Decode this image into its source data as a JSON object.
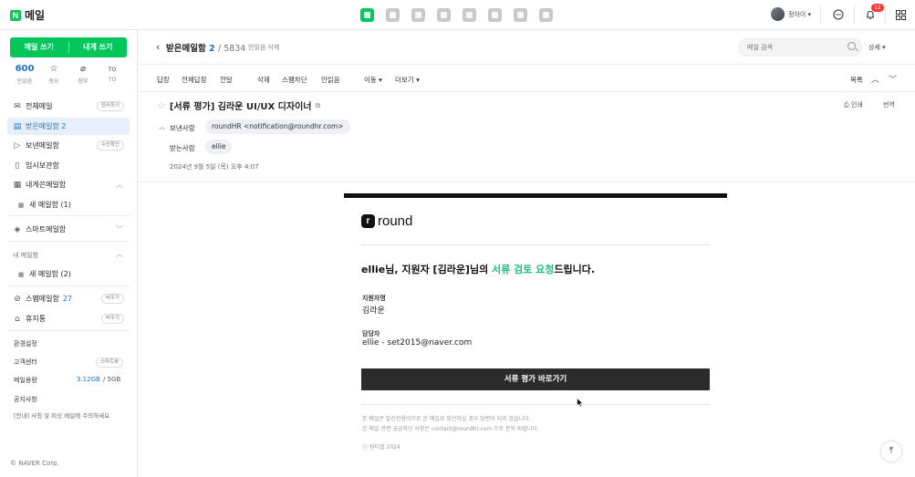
{
  "header": {
    "logo_letter": "N",
    "logo_text": "메일",
    "apps": [
      "mail-icon",
      "calendar-icon",
      "contacts-card-icon",
      "address-book-icon",
      "settings-hex-icon",
      "notes-icon",
      "home-icon",
      "bookmark-icon"
    ],
    "user_name": "정아이 ▾",
    "notif_count": "12",
    "accent": "#03c75a"
  },
  "sidebar": {
    "compose_label": "메일 쓰기",
    "compose_self_label": "내게 쓰기",
    "quick": [
      {
        "value": "600",
        "label": "안읽음"
      },
      {
        "icon": "☆",
        "label": "중요"
      },
      {
        "icon": "⌀",
        "label": "첨부"
      },
      {
        "icon": "TO",
        "label": "TO"
      }
    ],
    "items": [
      {
        "label": "전체메일",
        "pill": "정리하기"
      },
      {
        "label": "받은메일함 2"
      },
      {
        "label": "보낸메일함",
        "pill": "수신확인"
      },
      {
        "label": "임시보관함"
      },
      {
        "label": "내게쓴메일함"
      },
      {
        "label": "새 메일함 (1)"
      },
      {
        "label": "스마트메일함"
      },
      {
        "label": "새 메일함 (2)"
      },
      {
        "label": "스팸메일함",
        "count": "27",
        "pill": "비우기"
      },
      {
        "label": "휴지통",
        "pill": "비우기"
      }
    ],
    "my_mailbox_label": "내 메일함",
    "settings_label": "환경설정",
    "support_label": "고객센터",
    "support_pill": "스마트봇",
    "storage_label": "메일용량",
    "storage_used": "3.12GB",
    "storage_total": "/ 5GB",
    "notice_label": "공지사항",
    "notice_text": "[안내] 사칭 및 피싱 메일에 주의하세요",
    "copyright": "© NAVER Corp."
  },
  "mailbar": {
    "folder_name": "받은메일함",
    "unread": "2",
    "total": "/ 5834",
    "delete_unread": "안읽음 삭제",
    "search_placeholder": "메일 검색",
    "detail_label": "상세 ▾"
  },
  "toolbar": {
    "reply": "답장",
    "reply_all": "전체답장",
    "forward": "전달",
    "delete": "삭제",
    "spam": "스팸차단",
    "unread": "안읽음",
    "move": "이동 ▾",
    "more": "더보기 ▾",
    "list": "목록"
  },
  "message": {
    "subject": "[서류 평가] 김라운 UI/UX 디자이너",
    "print": "인쇄",
    "translate": "번역",
    "from_label": "보낸사람",
    "from": "roundHR <notification@roundhr.com>",
    "to_label": "받는사람",
    "to": "ellie",
    "date": "2024년 9월 5일 (목) 오후 4:07"
  },
  "email": {
    "brand_mark": "r",
    "brand_name": "round",
    "headline_pre": "ellie님, 지원자 [김라운]님의 ",
    "headline_hl": "서류 검토 요청",
    "headline_post": "드립니다.",
    "applicant_label": "지원자명",
    "applicant": "김라운",
    "manager_label": "담당자",
    "manager": "ellie - set2015@naver.com",
    "cta": "서류 평가 바로가기",
    "fine1": "본 메일은 발신전용이므로 본 메일로 회신하실 경우 답변이 되지 않습니다.",
    "fine2": "본 메일 관련 궁금하신 사항은 contact@roundhr.com 으로 문의 바랍니다.",
    "fine3": "ⓒ 원티랩 2024",
    "highlight_color": "#1fbf7a"
  }
}
